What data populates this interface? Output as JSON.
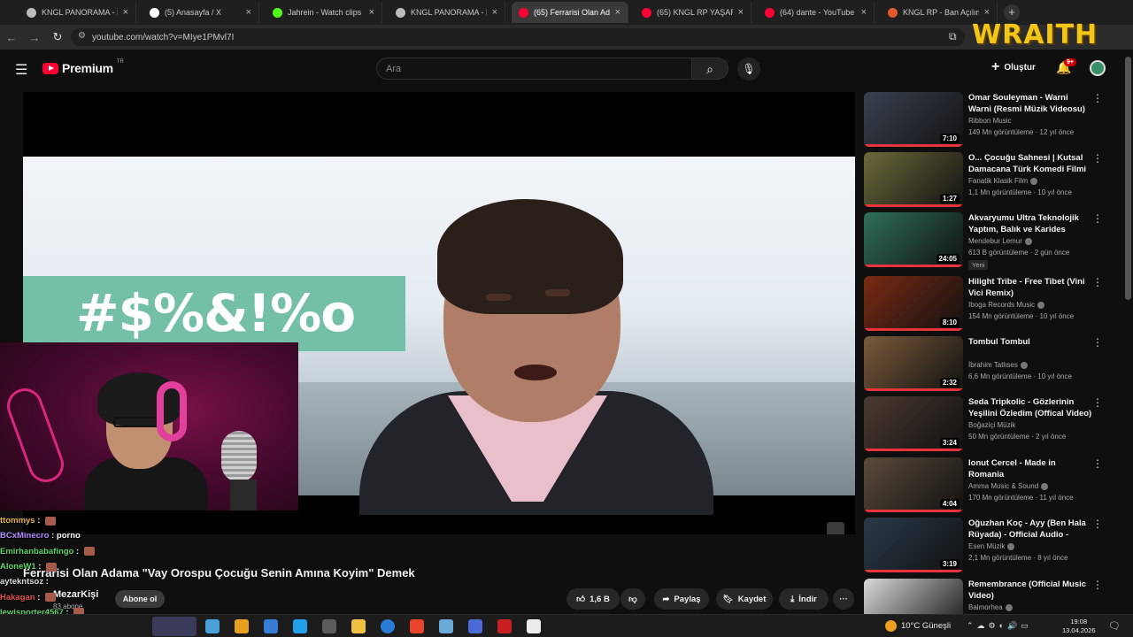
{
  "tabs": [
    {
      "title": "KNGL PANORAMA - İhba",
      "favicon_color": "#bbbbbb"
    },
    {
      "title": "(5) Anasayfa / X",
      "favicon_color": "#ffffff"
    },
    {
      "title": "Jahrein - Watch clips on K",
      "favicon_color": "#53fc18"
    },
    {
      "title": "KNGL PANORAMA - Kom",
      "favicon_color": "#bbbbbb"
    },
    {
      "title": "(65) Ferrarisi Olan Adama",
      "favicon_color": "#ff0033"
    },
    {
      "title": "(65) KNGL RP YAŞAR KAÇ",
      "favicon_color": "#ff0033"
    },
    {
      "title": "(64) dante - YouTube",
      "favicon_color": "#ff0033"
    },
    {
      "title": "KNGL RP - Ban Açılım",
      "favicon_color": "#e05a2a"
    }
  ],
  "browser": {
    "url": "youtube.com/watch?v=MIye1PMvl7I"
  },
  "overlay": {
    "brand": "WRAITH"
  },
  "header": {
    "logo_label": "Premium",
    "logo_region": "TR",
    "search_placeholder": "Ara",
    "create_label": "Oluştur",
    "notification_count": "9+"
  },
  "video": {
    "banner_text": "#$%&!%o",
    "title": "Ferrarisi Olan Adama \"Vay Orospu Çocuğu Senin Amına Koyim\" Demek",
    "channel": "MezarKişi",
    "subscribers": "83 abone",
    "subscribe_label": "Abone ol",
    "likes": "1,6 B",
    "share_label": "Paylaş",
    "save_label": "Kaydet",
    "download_label": "İndir"
  },
  "chat": [
    {
      "user": "ttommys",
      "msg": "",
      "color": "#e8b34a",
      "emote": true
    },
    {
      "user": "BCxMinecro",
      "msg": "porno",
      "color": "#b08cff",
      "emote": false
    },
    {
      "user": "Emirhanbabafingo",
      "msg": "",
      "color": "#5fd36a",
      "emote": true
    },
    {
      "user": "AloneW1",
      "msg": "",
      "color": "#5fd36a",
      "emote": true
    },
    {
      "user": "aytekntsoz",
      "msg": "",
      "color": "#dddddd",
      "emote": false
    },
    {
      "user": "Hakagan",
      "msg": "",
      "color": "#e05050",
      "emote": true
    },
    {
      "user": "lewisporter4567",
      "msg": "",
      "color": "#5fd36a",
      "emote": true
    },
    {
      "user": "Emirhanbabafingo",
      "msg": "",
      "color": "#5fd36a",
      "emote": true
    }
  ],
  "sidebar": [
    {
      "title": "Omar Souleyman - Warni Warni (Resmi Müzik Videosu)",
      "channel": "Ribbon Music",
      "verified": false,
      "meta": "149 Mn görüntüleme · 12 yıl önce",
      "duration": "7:10",
      "thumb": "#3a4250",
      "new": false
    },
    {
      "title": "O... Çocuğu Sahnesi | Kutsal Damacana Türk Komedi Filmi",
      "channel": "Fanatik Klasik Film",
      "verified": true,
      "meta": "1,1 Mn görüntüleme · 10 yıl önce",
      "duration": "1:27",
      "thumb": "#6b6a3a",
      "new": false
    },
    {
      "title": "Akvaryumu Ultra Teknolojik Yaptım, Balık ve Karides Aldım!",
      "channel": "Mendebur Lemur",
      "verified": true,
      "meta": "613 B görüntüleme · 2 gün önce",
      "duration": "24:05",
      "thumb": "#2f6f5a",
      "new": true,
      "new_label": "Yeni"
    },
    {
      "title": "Hilight Tribe - Free Tibet (Vini Vici Remix)",
      "channel": "Iboga Records Music",
      "verified": true,
      "meta": "154 Mn görüntüleme · 10 yıl önce",
      "duration": "8:10",
      "thumb": "#7a2a12",
      "new": false
    },
    {
      "title": "Tombul Tombul",
      "channel": "İbrahim Tatlıses",
      "verified": true,
      "meta": "6,6 Mn görüntüleme · 10 yıl önce",
      "duration": "2:32",
      "thumb": "#7a5a3a",
      "new": false
    },
    {
      "title": "Seda Tripkolic - Gözlerinin Yeşilini Özledim (Offical Video)",
      "channel": "Boğaziçi Müzik",
      "verified": false,
      "meta": "50 Mn görüntüleme · 2 yıl önce",
      "duration": "3:24",
      "thumb": "#4a3a30",
      "new": false
    },
    {
      "title": "Ionut Cercel - Made in Romania",
      "channel": "Amma Music & Sound",
      "verified": true,
      "meta": "170 Mn görüntüleme · 11 yıl önce",
      "duration": "4:04",
      "thumb": "#5a4a3a",
      "new": false
    },
    {
      "title": "Oğuzhan Koç - Ayy (Ben Hala Rüyada) - Official Audio - Esen...",
      "channel": "Esen Müzik",
      "verified": true,
      "meta": "2,1 Mn görüntüleme · 8 yıl önce",
      "duration": "3:19",
      "thumb": "#2a3a4a",
      "new": false
    },
    {
      "title": "Remembrance (Official Music Video)",
      "channel": "Balmorhea",
      "verified": true,
      "meta": "",
      "duration": "",
      "thumb": "#d8d8d8",
      "new": false
    }
  ],
  "taskbar": {
    "weather": "10°C Güneşli",
    "time": "19:08",
    "date": "13.04.2026",
    "icon_colors": [
      "#4a9fd8",
      "#e8a020",
      "#3a7bd5",
      "#1fa0e8",
      "#5a5a5a",
      "#f0c040",
      "#2a7bd8",
      "#e8452a",
      "#6aa8d8",
      "#4a6ad8",
      "#c82020",
      "#ececec"
    ]
  }
}
